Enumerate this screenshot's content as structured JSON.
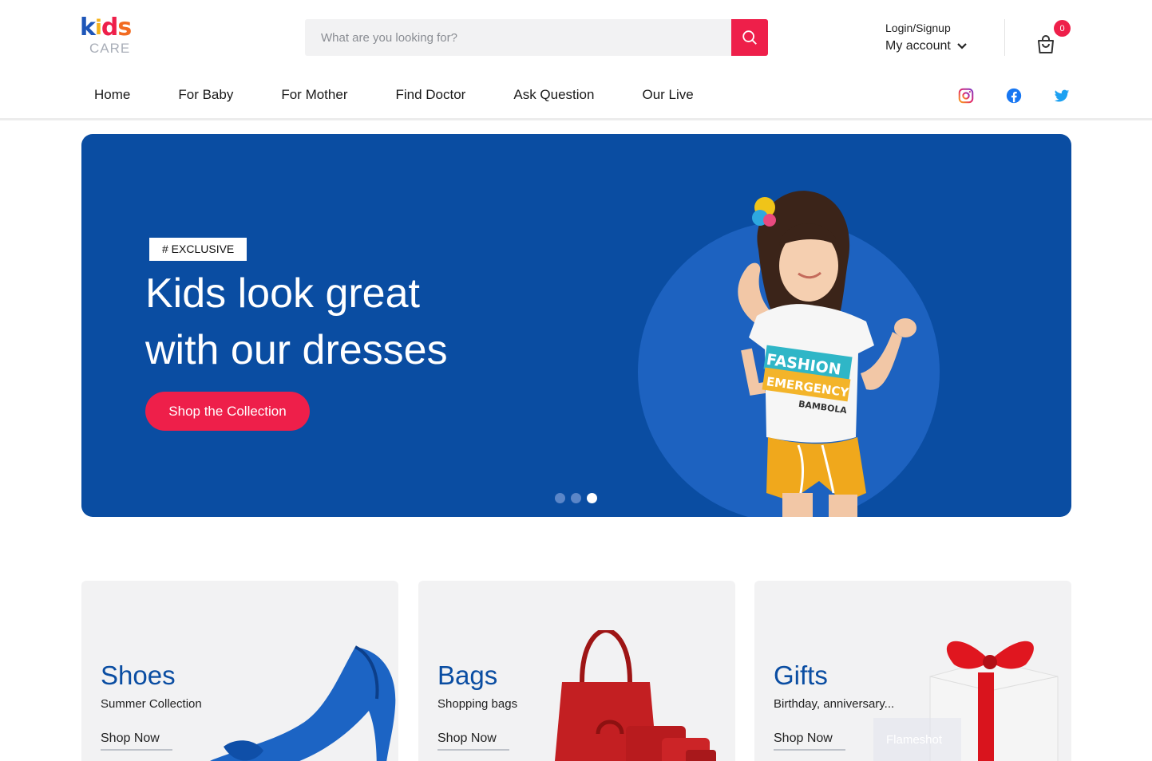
{
  "brand": {
    "logo_letters": [
      "k",
      "i",
      "d",
      "s"
    ],
    "logo_sub": "CARE"
  },
  "search": {
    "placeholder": "What are you looking for?"
  },
  "account": {
    "login_label": "Login/Signup",
    "account_label": "My account"
  },
  "cart": {
    "count": "0"
  },
  "nav": {
    "items": [
      {
        "label": "Home"
      },
      {
        "label": "For Baby"
      },
      {
        "label": "For Mother"
      },
      {
        "label": "Find Doctor"
      },
      {
        "label": "Ask Question"
      },
      {
        "label": "Our Live"
      }
    ],
    "active_index": 0
  },
  "social": [
    "instagram-icon",
    "facebook-icon",
    "twitter-icon"
  ],
  "hero": {
    "tag": "# EXCLUSIVE",
    "title_line1": "Kids look great",
    "title_line2": "with our dresses",
    "cta": "Shop the Collection",
    "slides_total": 3,
    "active_slide": 3,
    "shirt_text1": "FASHION",
    "shirt_text2": "EMERGENCY",
    "shirt_text3": "BAMBOLA"
  },
  "categories": [
    {
      "title": "Shoes",
      "subtitle": "Summer Collection",
      "link": "Shop Now"
    },
    {
      "title": "Bags",
      "subtitle": "Shopping bags",
      "link": "Shop Now"
    },
    {
      "title": "Gifts",
      "subtitle": "Birthday, anniversary...",
      "link": "Shop Now"
    }
  ],
  "overlay": {
    "label": "Flameshot"
  },
  "colors": {
    "primary_blue": "#0a4da2",
    "accent_red": "#ee1f4a",
    "card_bg": "#f2f2f3"
  }
}
